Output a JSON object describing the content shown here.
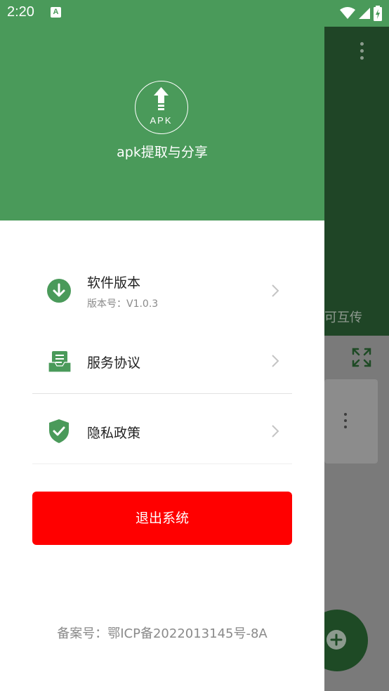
{
  "status_bar": {
    "time": "2:20",
    "notification_icon_letter": "A",
    "icons": [
      "wifi-icon",
      "signal-icon",
      "battery-charging-icon"
    ]
  },
  "background_app": {
    "partial_text": "可互传",
    "icons": [
      "more-vert-icon",
      "expand-icon",
      "more-vert-icon",
      "add-fab-icon"
    ]
  },
  "drawer": {
    "logo_text": "APK",
    "app_name": "apk提取与分享",
    "menu": [
      {
        "label": "软件版本",
        "sub": "版本号：V1.0.3",
        "icon": "download-circle-icon"
      },
      {
        "label": "服务协议",
        "icon": "document-tray-icon"
      },
      {
        "label": "隐私政策",
        "icon": "shield-check-icon"
      }
    ],
    "logout_label": "退出系统",
    "icp": "备案号：鄂ICP备2022013145号-8A"
  },
  "colors": {
    "header_green": "#4a9a5a",
    "icon_green": "#4a9a5a",
    "logout_red": "#ff0000",
    "dim_appbar": "#1f4526"
  }
}
